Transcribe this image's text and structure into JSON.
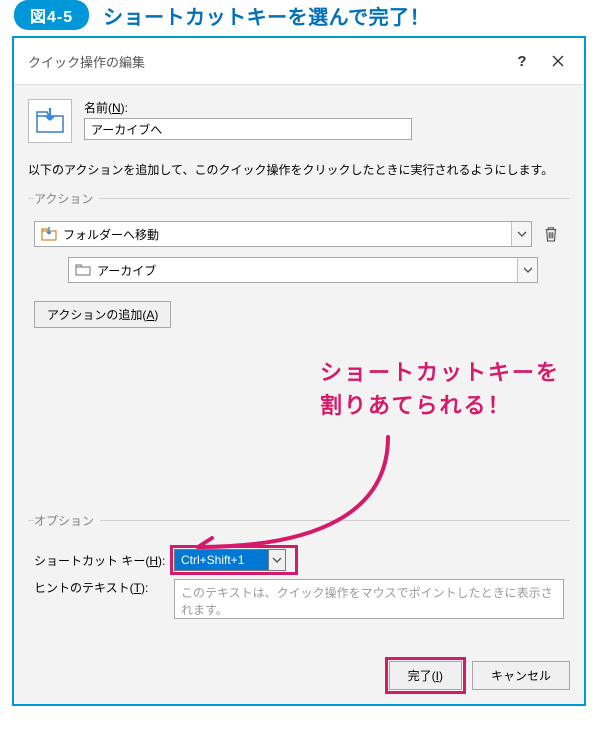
{
  "figure": {
    "badge": "図4-5",
    "title": "ショートカットキーを選んで完了！"
  },
  "dialog": {
    "title": "クイック操作の編集",
    "help": "?",
    "close": "✕"
  },
  "name": {
    "label_prefix": "名前(",
    "label_u": "N",
    "label_suffix": "):",
    "value": "アーカイブへ"
  },
  "instruction": "以下のアクションを追加して、このクイック操作をクリックしたときに実行されるようにします。",
  "actions": {
    "legend": "アクション",
    "action1": "フォルダーへ移動",
    "action2": "アーカイブ",
    "add_prefix": "アクションの追加(",
    "add_u": "A",
    "add_suffix": ")"
  },
  "handwriting": "ショートカットキーを\n割りあてられる！",
  "options": {
    "legend": "オプション",
    "shortcut_label_prefix": "ショートカット キー(",
    "shortcut_label_u": "H",
    "shortcut_label_suffix": "):",
    "shortcut_value": "Ctrl+Shift+1",
    "hint_label_prefix": "ヒントのテキスト(",
    "hint_label_u": "T",
    "hint_label_suffix": "):",
    "hint_placeholder": "このテキストは、クイック操作をマウスでポイントしたときに表示されます。"
  },
  "footer": {
    "finish_prefix": "完了(",
    "finish_u": "I",
    "finish_suffix": ")",
    "cancel": "キャンセル"
  },
  "colors": {
    "accent": "#0097d8",
    "brand_head": "#0070b8",
    "callout": "#d61a6a",
    "selection": "#0078d4"
  }
}
